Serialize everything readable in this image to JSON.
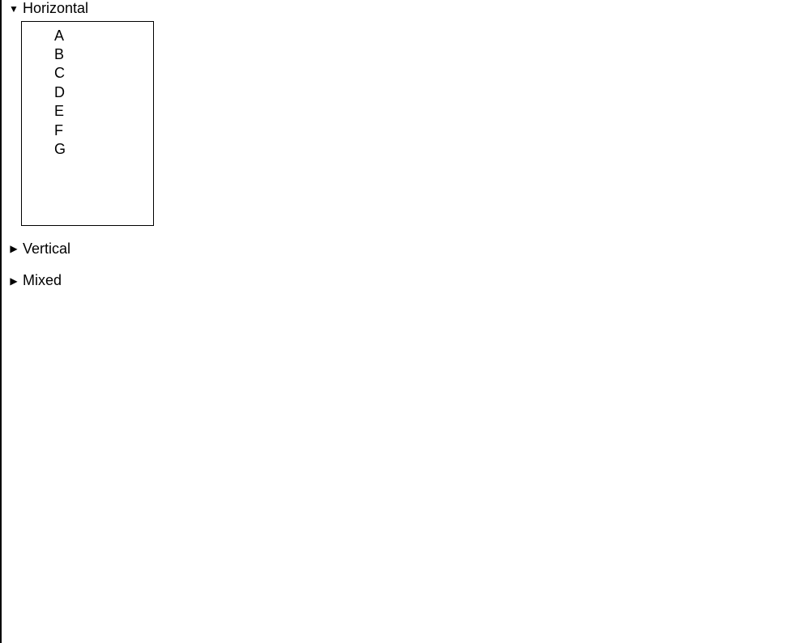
{
  "sections": {
    "horizontal": {
      "label": "Horizontal",
      "expanded": true,
      "items": [
        "A",
        "B",
        "C",
        "D",
        "E",
        "F",
        "G"
      ]
    },
    "vertical": {
      "label": "Vertical",
      "expanded": false
    },
    "mixed": {
      "label": "Mixed",
      "expanded": false
    }
  }
}
